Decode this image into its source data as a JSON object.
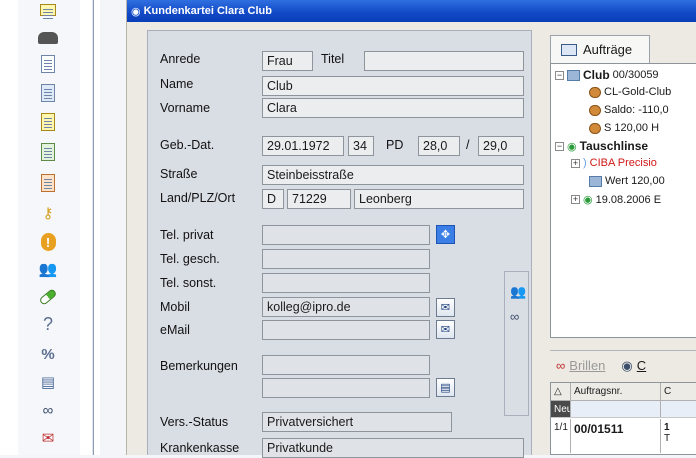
{
  "toolbar": {
    "icons": [
      "notepad-icon",
      "hat-icon",
      "document-icon",
      "glasses-document-icon",
      "document-yellow-icon",
      "document-green-icon",
      "document-orange-icon",
      "keys-icon",
      "exclamation-icon",
      "people-icon",
      "pill-icon",
      "ear-icon",
      "percent-icon",
      "print-icon",
      "glasses-icon",
      "mail-alert-icon"
    ]
  },
  "window": {
    "title": "Kundenkartei Clara Club"
  },
  "form": {
    "labels": {
      "anrede": "Anrede",
      "titel": "Titel",
      "name": "Name",
      "vorname": "Vorname",
      "gebdat": "Geb.-Dat.",
      "pd": "PD",
      "strasse": "Straße",
      "land_plz_ort": "Land/PLZ/Ort",
      "tel_privat": "Tel. privat",
      "tel_gesch": "Tel. gesch.",
      "tel_sonst": "Tel. sonst.",
      "mobil": "Mobil",
      "email": "eMail",
      "bemerkungen": "Bemerkungen",
      "vers_status": "Vers.-Status",
      "krankenkasse": "Krankenkasse"
    },
    "values": {
      "anrede": "Frau",
      "titel": "",
      "name": "Club",
      "vorname": "Clara",
      "gebdat": "29.01.1972",
      "alter": "34",
      "pd_left": "28,0",
      "pd_sep": "/",
      "pd_right": "29,0",
      "strasse": "Steinbeisstraße",
      "land": "D",
      "plz": "71229",
      "ort": "Leonberg",
      "tel_privat": "",
      "tel_gesch": "",
      "tel_sonst": "",
      "mobil": "kolleg@ipro.de",
      "email": "",
      "bemerkungen1": "",
      "bemerkungen2": "",
      "vers_status": "Privatversichert",
      "krankenkasse": "Privatkunde"
    }
  },
  "right": {
    "tab_label": "Aufträge",
    "tree": [
      {
        "pm": "−",
        "label": "Club",
        "suffix": " 00/30059",
        "bold": true
      },
      {
        "label": "CL-Gold-Club"
      },
      {
        "label": "Saldo: -110,0"
      },
      {
        "label": "S  120,00  H"
      },
      {
        "pm": "−",
        "label": "Tauschlinse",
        "bold": true
      },
      {
        "pm": "+",
        "label": "CIBA Precisio",
        "red": true
      },
      {
        "label": "Wert  120,00"
      },
      {
        "pm": "+",
        "label": "19.08.2006 E"
      }
    ],
    "bottom_tabs": {
      "brillen": "Brillen",
      "other": "C"
    },
    "grid": {
      "headers": [
        "",
        "Auftragsnr.",
        "C"
      ],
      "new_row": "Neu",
      "row": {
        "idx": "1/1",
        "nr": "00/01511",
        "c": "1",
        "c2": "T"
      }
    }
  },
  "colors": {
    "title_bar": "#1148c6",
    "form_panel": "#d9dde4",
    "field_bg": "#ecedee",
    "red_item": "#d01818"
  }
}
